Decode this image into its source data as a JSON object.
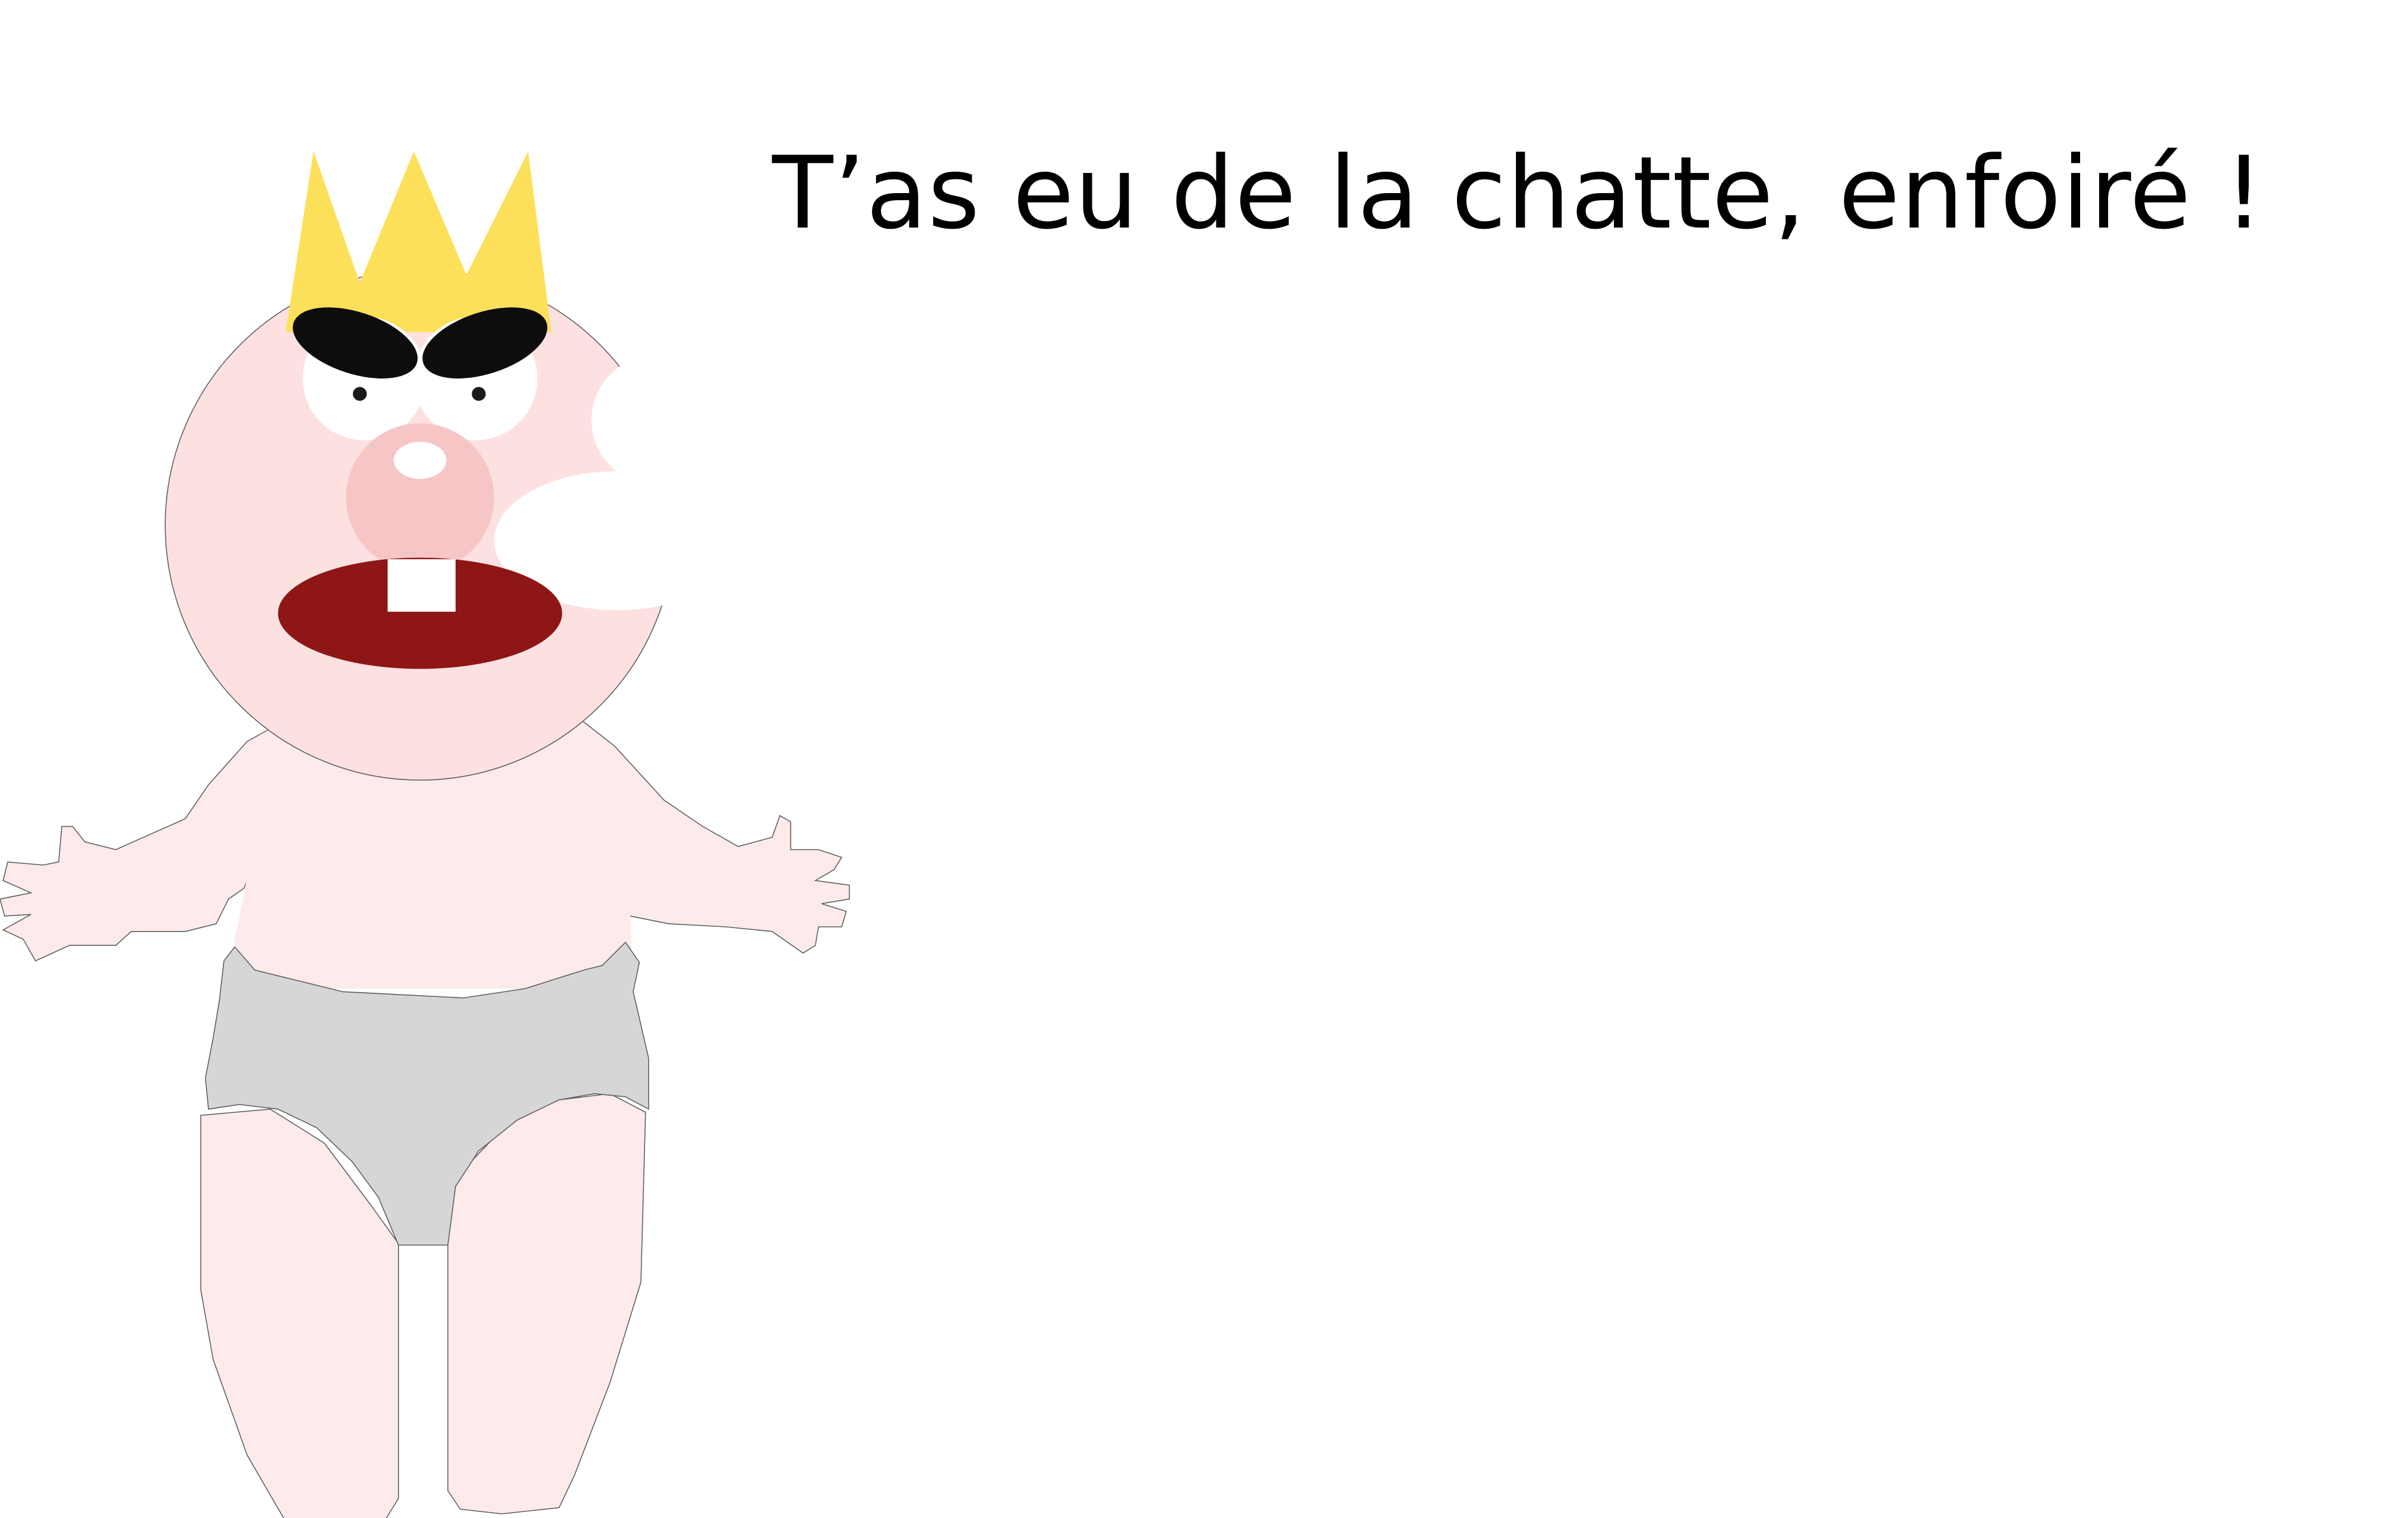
{
  "caption": {
    "text": "T’as eu de la chatte, enfoiré !"
  },
  "character": {
    "description_icon": "crowned-baby-illustration",
    "colors": {
      "skin": "#fdeaea",
      "face": "#fde1e1",
      "outline": "#5c5c5c",
      "crown": "#fde05a",
      "brows": "#0d0d0d",
      "mouth": "#8e1616",
      "nose": "#f6c6c6",
      "diaper": "#d6d6d6",
      "white": "#ffffff"
    }
  }
}
